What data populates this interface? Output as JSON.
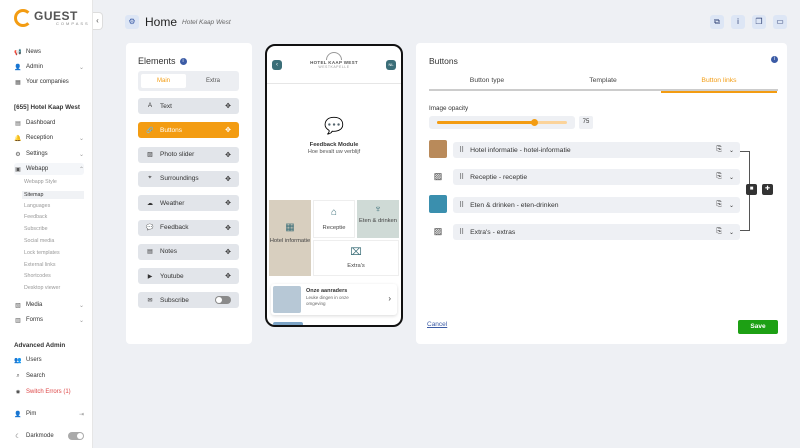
{
  "brand": {
    "name": "GUEST",
    "tagline": "COMPASS"
  },
  "sidebar": {
    "top": [
      {
        "label": "News",
        "icon": "megaphone-icon",
        "chev": ""
      },
      {
        "label": "Admin",
        "icon": "admin-icon",
        "chev": "⌄"
      },
      {
        "label": "Your companies",
        "icon": "building-icon",
        "chev": ""
      }
    ],
    "hotel_title": "[655] Hotel Kaap West",
    "hotel_items": [
      {
        "label": "Dashboard",
        "icon": "chart-icon",
        "chev": ""
      },
      {
        "label": "Reception",
        "icon": "bell-icon",
        "chev": "⌄"
      },
      {
        "label": "Settings",
        "icon": "gear-icon",
        "chev": "⌄"
      },
      {
        "label": "Webapp",
        "icon": "webapp-icon",
        "chev": "⌃"
      }
    ],
    "webapp_sub": [
      "Webapp Style",
      "Sitemap",
      "Languages",
      "Feedback",
      "Subscribe",
      "Social media",
      "Lock templates",
      "External links",
      "Shortcodes",
      "Desktop viewer"
    ],
    "after_items": [
      {
        "label": "Media",
        "icon": "media-icon",
        "chev": "⌄"
      },
      {
        "label": "Forms",
        "icon": "forms-icon",
        "chev": "⌄"
      }
    ],
    "adv_title": "Advanced Admin",
    "adv_items": [
      {
        "label": "Users",
        "icon": "users-icon"
      },
      {
        "label": "Search",
        "icon": "search-icon"
      },
      {
        "label": "Switch Errors (1)",
        "icon": "bug-icon"
      }
    ],
    "user": "Pim",
    "darkmode": "Darkmode"
  },
  "header": {
    "title": "Home",
    "subtitle": "Hotel Kaap West"
  },
  "elements": {
    "title": "Elements",
    "seg": [
      "Main",
      "Extra"
    ],
    "items": [
      {
        "label": "Text",
        "icon": "text-icon"
      },
      {
        "label": "Buttons",
        "icon": "link-icon",
        "selected": true
      },
      {
        "label": "Photo slider",
        "icon": "image-icon"
      },
      {
        "label": "Surroundings",
        "icon": "pin-icon"
      },
      {
        "label": "Weather",
        "icon": "cloud-icon"
      },
      {
        "label": "Feedback",
        "icon": "chat-icon"
      },
      {
        "label": "Notes",
        "icon": "note-icon"
      },
      {
        "label": "Youtube",
        "icon": "youtube-icon"
      },
      {
        "label": "Subscribe",
        "icon": "subscribe-icon",
        "toggle": true
      }
    ]
  },
  "phone": {
    "logo_t1": "HOTEL KAAP WEST",
    "logo_t2": "WESTKAPELLE",
    "lang": "NL",
    "fb_title": "Feedback Module",
    "fb_sub": "Hoe bevalt uw verblijf",
    "tiles": [
      "Hotel informatie",
      "Receptie",
      "Eten & drinken",
      "Extra's"
    ],
    "list_title": "Onze aanraders",
    "list_sub": "Leuke dingen in onze omgeving"
  },
  "buttons": {
    "title": "Buttons",
    "tabs": [
      "Button type",
      "Template",
      "Button links"
    ],
    "opacity_label": "Image opacity",
    "opacity_value": "75",
    "links": [
      {
        "label": "Hotel informatie - hotel-informatie",
        "thumb": "#b98a5a"
      },
      {
        "label": "Receptie - receptie",
        "thumb": ""
      },
      {
        "label": "Eten & drinken - eten-drinken",
        "thumb": "#3a8fae"
      },
      {
        "label": "Extra's - extras",
        "thumb": ""
      }
    ],
    "cancel": "Cancel",
    "save": "Save"
  },
  "colors": {
    "accent": "#f39c12",
    "save": "#1da014",
    "navy": "#3b5ba5"
  }
}
